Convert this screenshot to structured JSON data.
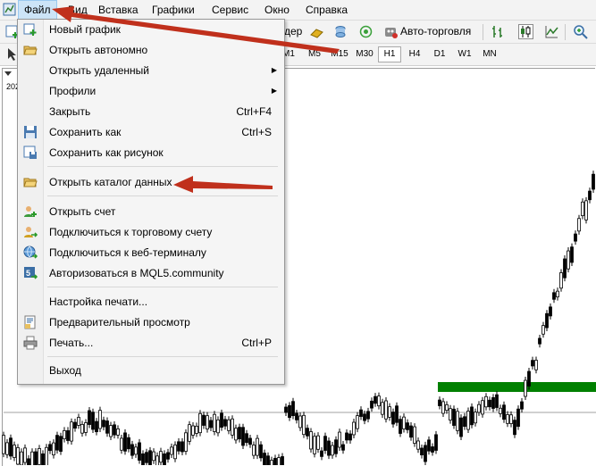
{
  "menubar": {
    "items": [
      "Файл",
      "Вид",
      "Вставка",
      "Графики",
      "Сервис",
      "Окно",
      "Справка"
    ]
  },
  "toolbar": {
    "tail_text": "дер",
    "autotrade_label": "Авто-торговля"
  },
  "timeframes": [
    "M1",
    "M5",
    "M15",
    "M30",
    "H1",
    "H4",
    "D1",
    "W1",
    "MN"
  ],
  "active_timeframe": "H1",
  "chart": {
    "date_label": "202",
    "level_color": "#008000",
    "candle_color": "#000000"
  },
  "file_menu": {
    "items": [
      {
        "label": "Новый график",
        "shortcut": "",
        "submenu": false,
        "icon": "new-chart-icon"
      },
      {
        "label": "Открыть автономно",
        "shortcut": "",
        "submenu": false,
        "icon": "open-folder-icon"
      },
      {
        "label": "Открыть удаленный",
        "shortcut": "",
        "submenu": true,
        "icon": ""
      },
      {
        "label": "Профили",
        "shortcut": "",
        "submenu": true,
        "icon": ""
      },
      {
        "label": "Закрыть",
        "shortcut": "Ctrl+F4",
        "submenu": false,
        "icon": ""
      },
      {
        "label": "Сохранить как",
        "shortcut": "Ctrl+S",
        "submenu": false,
        "icon": "floppy-disk-icon"
      },
      {
        "label": "Сохранить как рисунок",
        "shortcut": "",
        "submenu": false,
        "icon": "save-picture-icon"
      },
      {
        "label": "Открыть каталог данных",
        "shortcut": "",
        "submenu": false,
        "icon": "folder-icon"
      },
      {
        "label": "Открыть счет",
        "shortcut": "",
        "submenu": false,
        "icon": "open-account-icon"
      },
      {
        "label": "Подключиться к торговому счету",
        "shortcut": "",
        "submenu": false,
        "icon": "connect-account-icon"
      },
      {
        "label": "Подключиться к веб-терминалу",
        "shortcut": "",
        "submenu": false,
        "icon": "web-terminal-icon"
      },
      {
        "label": "Авторизоваться в MQL5.community",
        "shortcut": "",
        "submenu": false,
        "icon": "mql5-login-icon"
      },
      {
        "label": "Настройка печати...",
        "shortcut": "",
        "submenu": false,
        "icon": ""
      },
      {
        "label": "Предварительный просмотр",
        "shortcut": "",
        "submenu": false,
        "icon": "print-preview-icon"
      },
      {
        "label": "Печать...",
        "shortcut": "Ctrl+P",
        "submenu": false,
        "icon": "printer-icon"
      },
      {
        "label": "Выход",
        "shortcut": "",
        "submenu": false,
        "icon": ""
      }
    ]
  },
  "colors": {
    "annotation_arrow": "#c0301c",
    "menu_highlight": "#cce4f7"
  }
}
